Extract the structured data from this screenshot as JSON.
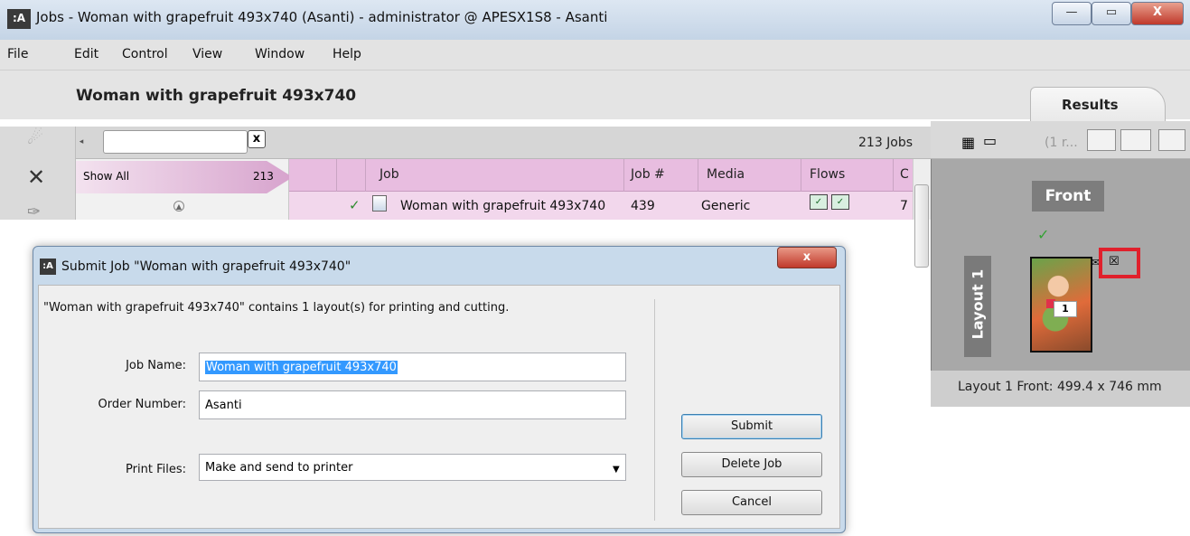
{
  "main_window": {
    "title": "Jobs - Woman with grapefruit 493x740 (Asanti) - administrator @ APESX1S8 - Asanti",
    "logo": ":A",
    "controls": {
      "minimize": "—",
      "maximize": "▭",
      "close": "X"
    }
  },
  "menu": [
    "File",
    "Edit",
    "Control",
    "View",
    "Window",
    "Help"
  ],
  "job_title": "Woman with grapefruit 493x740",
  "results_tab": "Results",
  "toolbar": {
    "search_value": "",
    "clear_glyph": "x",
    "job_count": "213 Jobs",
    "collapse_glyph": "◂"
  },
  "filter": {
    "label": "Show All",
    "count": "213"
  },
  "table": {
    "columns": [
      "Job",
      "Job #",
      "Media",
      "Flows",
      "C"
    ],
    "rows": [
      {
        "status": "✓",
        "job": "Woman with grapefruit 493x740",
        "job_no": "439",
        "media": "Generic",
        "c": "7"
      }
    ]
  },
  "results_pane": {
    "count_text": "(1 r...",
    "front_label": "Front",
    "layout_label": "Layout 1",
    "thumb_badge": "1",
    "info": "Layout 1 Front: 499.4 x 746 mm"
  },
  "dialog": {
    "title": "Submit Job \"Woman with grapefruit 493x740\"",
    "logo": ":A",
    "close": "x",
    "description": "\"Woman with grapefruit 493x740\" contains 1 layout(s) for printing and cutting.",
    "fields": {
      "job_name_label": "Job Name:",
      "job_name_value": "Woman with grapefruit 493x740",
      "order_number_label": "Order Number:",
      "order_number_value": "Asanti",
      "print_files_label": "Print Files:",
      "print_files_value": "Make and send to printer"
    },
    "buttons": {
      "submit": "Submit",
      "delete": "Delete Job",
      "cancel": "Cancel"
    }
  },
  "colors": {
    "accent_pink": "#e8bde0",
    "selection_blue": "#3399ff",
    "highlight_red": "#e0202c"
  }
}
